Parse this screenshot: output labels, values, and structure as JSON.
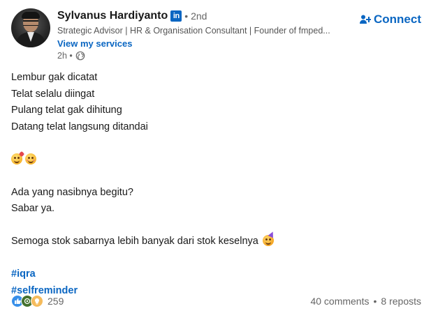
{
  "author": {
    "name": "Sylvanus Hardiyanto",
    "badge": "in",
    "degree": "• 2nd",
    "headline": "Strategic Advisor | HR & Organisation Consultant | Founder of fmped...",
    "services_link": "View my services",
    "time": "2h •",
    "visibility_icon": "globe-icon"
  },
  "connect_label": "Connect",
  "post": {
    "lines": [
      "Lembur gak dicatat",
      "Telat selalu diingat",
      "Pulang telat gak dihitung",
      "Datang telat langsung ditandai"
    ],
    "emoji_line": [
      "face-blowing-kiss-emoji",
      "smiling-face-emoji"
    ],
    "lines2": [
      "Ada yang nasibnya begitu?",
      "Sabar ya."
    ],
    "line3": "Semoga stok sabarnya lebih banyak dari stok keselnya",
    "line3_emoji": "partying-face-emoji",
    "hashtags": [
      "#iqra",
      "#selfreminder"
    ]
  },
  "social": {
    "reaction_icons": [
      "like-icon",
      "celebrate-icon",
      "insightful-icon"
    ],
    "reaction_count": "259",
    "comments": "40 comments",
    "separator": "•",
    "reposts": "8 reposts"
  },
  "colors": {
    "accent": "#0a66c2",
    "text": "#191919",
    "muted": "#666666"
  }
}
